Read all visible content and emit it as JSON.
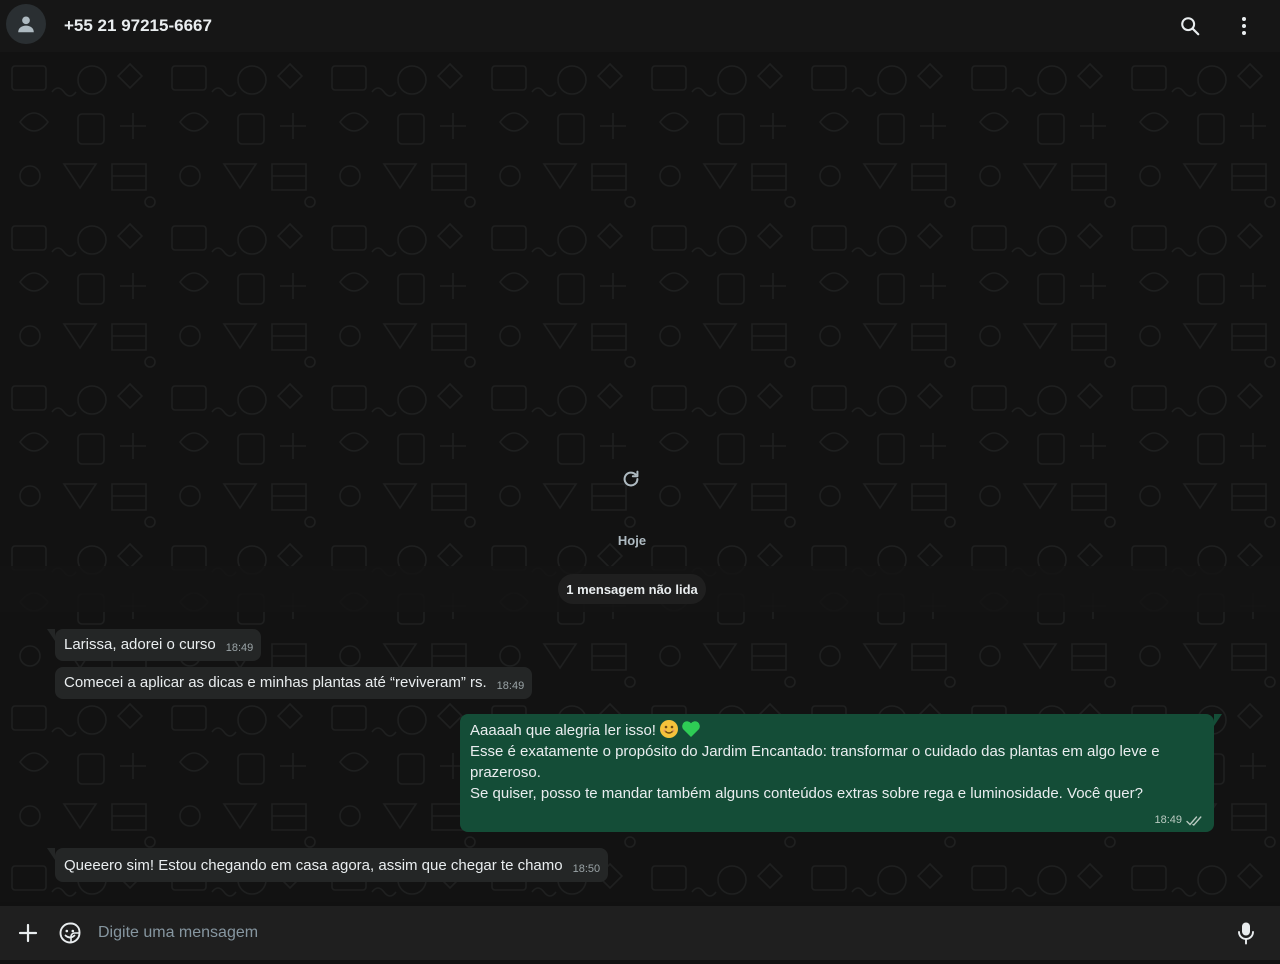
{
  "header": {
    "contact_name": "+55 21 97215-6667",
    "avatar_icon": "default-user-avatar",
    "search_icon": "search-icon",
    "menu_icon": "kebab-menu-icon"
  },
  "chat": {
    "loading_icon": "refresh-icon",
    "day_separator": "Hoje",
    "unread_notice": "1 mensagem não lida",
    "messages": [
      {
        "direction": "incoming",
        "text": "Larissa, adorei o curso",
        "time": "18:49"
      },
      {
        "direction": "incoming",
        "text": "Comecei a aplicar as dicas e minhas plantas até “reviveram” rs.",
        "time": "18:49"
      },
      {
        "direction": "outgoing",
        "line1": "Aaaaah que alegria ler isso!",
        "line2": "Esse é exatamente o propósito do Jardim Encantado: transformar o cuidado das plantas em algo leve e",
        "line3": "prazeroso.",
        "line4": "Se quiser, posso te mandar também alguns conteúdos extras sobre rega e luminosidade. Você quer?",
        "time": "18:49",
        "status": "read-double-check"
      },
      {
        "direction": "incoming",
        "text": "Queeero sim! Estou chegando em casa agora, assim que chegar te chamo",
        "time": "18:50"
      }
    ]
  },
  "composer": {
    "placeholder": "Digite uma mensagem",
    "value": "",
    "attach_icon": "plus-icon",
    "sticker_icon": "sticker-icon",
    "mic_icon": "microphone-icon"
  },
  "colors": {
    "outgoing_bubble": "#144d37",
    "incoming_bubble": "#242626",
    "background": "#121212",
    "heart_emoji": "#2ecc55"
  }
}
